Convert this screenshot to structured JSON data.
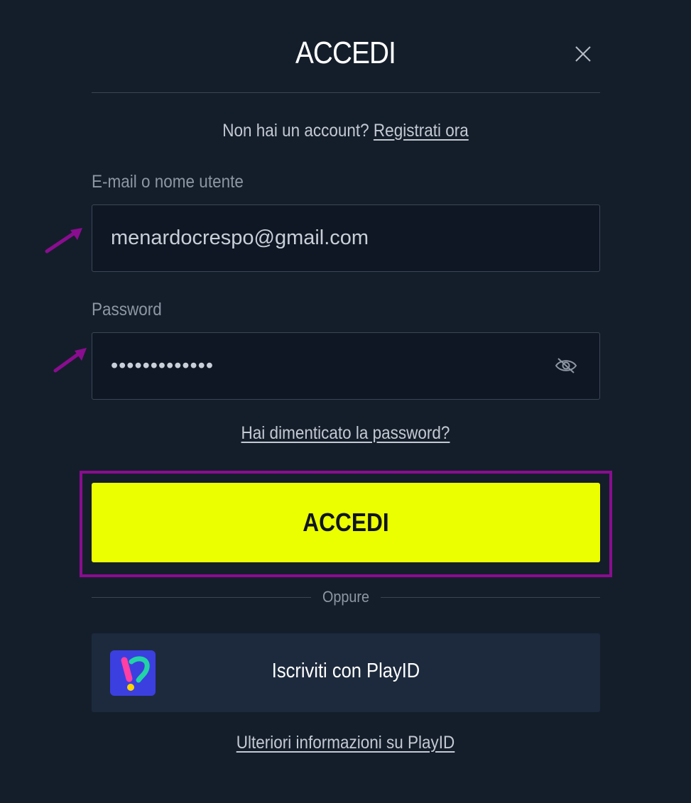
{
  "header": {
    "title": "ACCEDI",
    "close_icon": "close-icon"
  },
  "signup": {
    "prompt": "Non hai un account?",
    "link": "Registrati ora"
  },
  "form": {
    "email": {
      "label": "E-mail o nome utente",
      "value": "menardocrespo@gmail.com"
    },
    "password": {
      "label": "Password",
      "value": "•••••••••••••",
      "toggle_icon": "eye-slash-icon"
    },
    "forgot_link": "Hai dimenticato la password?",
    "submit_label": "ACCEDI"
  },
  "divider": {
    "or_text": "Oppure"
  },
  "playid": {
    "button_label": "Iscriviti con PlayID",
    "logo_icon": "playid-logo-icon",
    "more_info_link": "Ulteriori informazioni su PlayID"
  },
  "annotations": {
    "arrow_color": "#8a0d8f",
    "highlight_color": "#8a0d8f"
  },
  "colors": {
    "background": "#141e2b",
    "accent": "#ecff00",
    "input_bg": "#0f1724",
    "playid_bg": "#1d2a3d"
  }
}
